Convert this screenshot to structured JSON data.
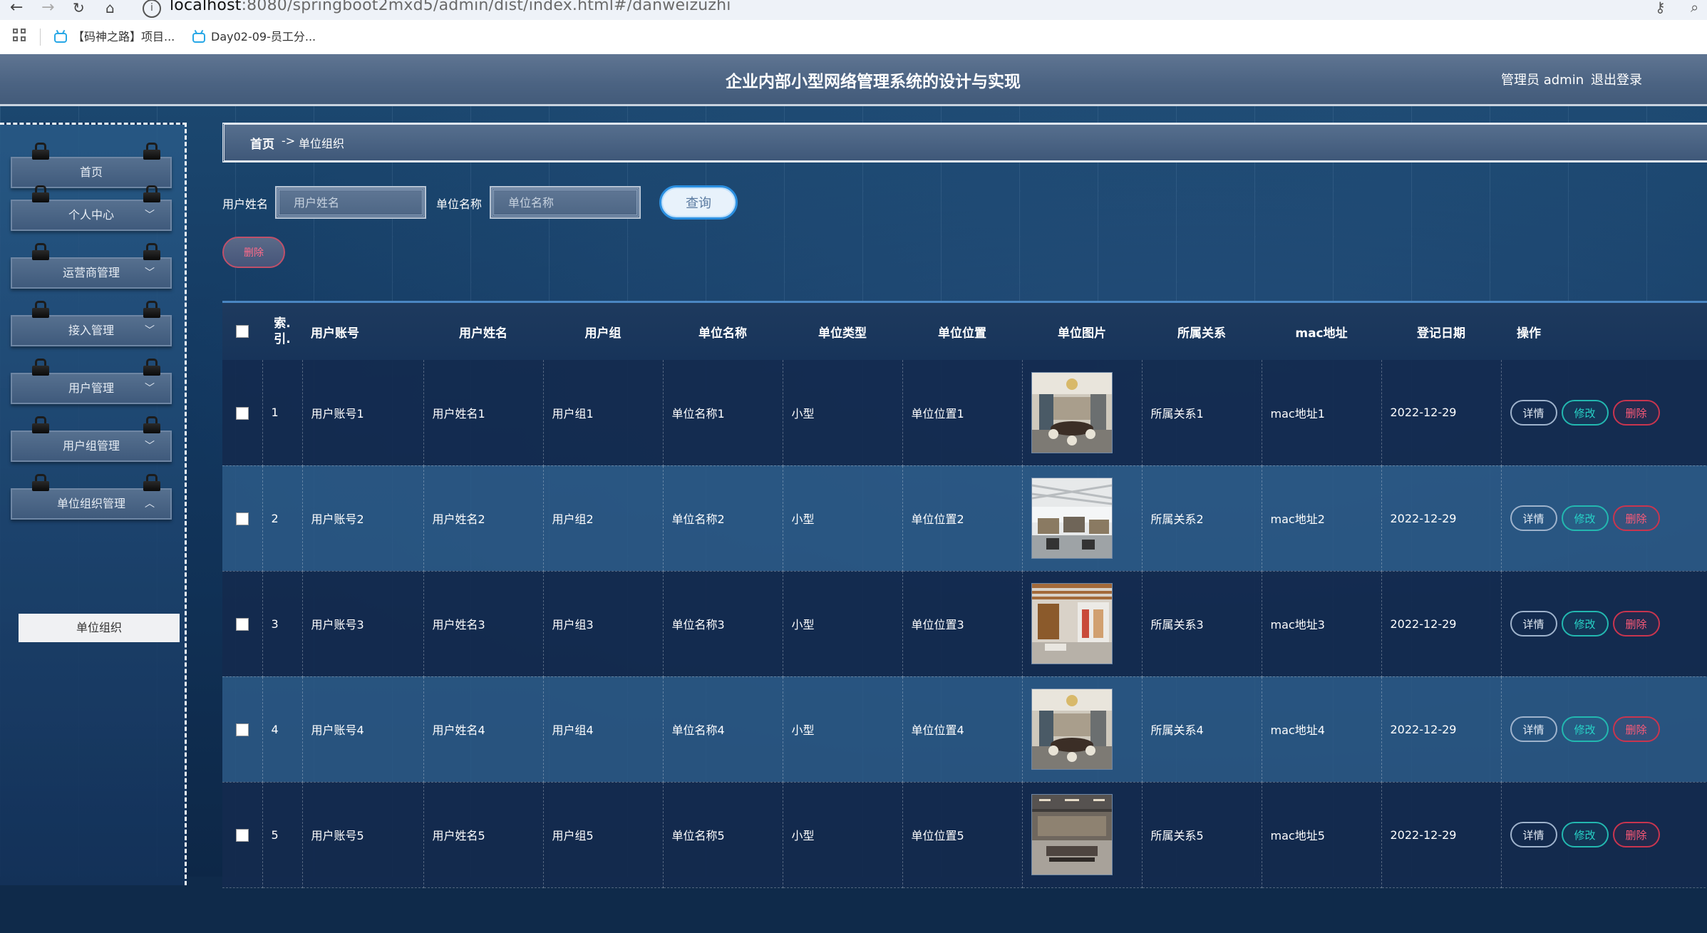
{
  "browser": {
    "url_host": "localhost",
    "url_path": ":8080/springboot2mxd5/admin/dist/index.html#/danweizuzhi",
    "bookmarks": [
      "【码神之路】项目...",
      "Day02-09-员工分..."
    ]
  },
  "app": {
    "title": "企业内部小型网络管理系统的设计与实现",
    "user_label": "管理员 admin",
    "logout_label": "退出登录",
    "accent_color": "#2b8fe0",
    "danger_color": "#c9354f",
    "success_color": "#23b8b0"
  },
  "sidebar": {
    "items": [
      {
        "label": "首页",
        "expandable": false
      },
      {
        "label": "个人中心",
        "expandable": true,
        "expanded": false
      },
      {
        "label": "运营商管理",
        "expandable": true,
        "expanded": false
      },
      {
        "label": "接入管理",
        "expandable": true,
        "expanded": false
      },
      {
        "label": "用户管理",
        "expandable": true,
        "expanded": false
      },
      {
        "label": "用户组管理",
        "expandable": true,
        "expanded": false
      },
      {
        "label": "单位组织管理",
        "expandable": true,
        "expanded": true
      }
    ],
    "submenu": [
      {
        "label": "单位组织"
      }
    ]
  },
  "breadcrumb": {
    "home": "首页",
    "separator": "->",
    "current": "单位组织"
  },
  "search": {
    "user_name_label": "用户姓名",
    "user_name_placeholder": "用户姓名",
    "user_name_value": "",
    "unit_name_label": "单位名称",
    "unit_name_placeholder": "单位名称",
    "unit_name_value": "",
    "query_label": "查询"
  },
  "actions": {
    "delete_label": "删除"
  },
  "table": {
    "headers": [
      "索引",
      "用户账号",
      "用户姓名",
      "用户组",
      "单位名称",
      "单位类型",
      "单位位置",
      "单位图片",
      "所属关系",
      "mac地址",
      "登记日期",
      "操作"
    ],
    "index_header_lines": [
      "索.",
      "引."
    ],
    "button_labels": {
      "detail": "详情",
      "edit": "修改",
      "delete": "删除"
    },
    "rows": [
      {
        "index": "1",
        "account": "用户账号1",
        "name": "用户姓名1",
        "group": "用户组1",
        "unit_name": "单位名称1",
        "unit_type": "小型",
        "location": "单位位置1",
        "image": "meeting-room",
        "relation": "所属关系1",
        "mac": "mac地址1",
        "date": "2022-12-29"
      },
      {
        "index": "2",
        "account": "用户账号2",
        "name": "用户姓名2",
        "group": "用户组2",
        "unit_name": "单位名称2",
        "unit_type": "小型",
        "location": "单位位置2",
        "image": "open-office",
        "relation": "所属关系2",
        "mac": "mac地址2",
        "date": "2022-12-29"
      },
      {
        "index": "3",
        "account": "用户账号3",
        "name": "用户姓名3",
        "group": "用户组3",
        "unit_name": "单位名称3",
        "unit_type": "小型",
        "location": "单位位置3",
        "image": "office-corridor",
        "relation": "所属关系3",
        "mac": "mac地址3",
        "date": "2022-12-29"
      },
      {
        "index": "4",
        "account": "用户账号4",
        "name": "用户姓名4",
        "group": "用户组4",
        "unit_name": "单位名称4",
        "unit_type": "小型",
        "location": "单位位置4",
        "image": "meeting-room",
        "relation": "所属关系4",
        "mac": "mac地址4",
        "date": "2022-12-29"
      },
      {
        "index": "5",
        "account": "用户账号5",
        "name": "用户姓名5",
        "group": "用户组5",
        "unit_name": "单位名称5",
        "unit_type": "小型",
        "location": "单位位置5",
        "image": "lobby",
        "relation": "所属关系5",
        "mac": "mac地址5",
        "date": "2022-12-29"
      }
    ]
  }
}
